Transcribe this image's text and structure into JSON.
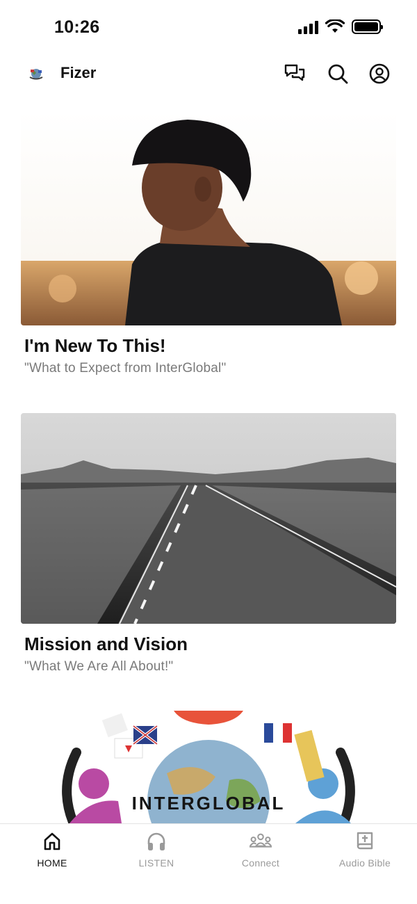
{
  "status_bar": {
    "time": "10:26"
  },
  "header": {
    "app_name": "Fizer"
  },
  "cards": [
    {
      "title": "I'm New To This!",
      "subtitle": "\"What to Expect from InterGlobal\""
    },
    {
      "title": "Mission and Vision",
      "subtitle": "\"What We Are All About!\""
    }
  ],
  "banner": {
    "logo_text": "INTERGLOBAL"
  },
  "nav": {
    "items": [
      {
        "label": "HOME",
        "icon": "home-icon",
        "active": true
      },
      {
        "label": "LISTEN",
        "icon": "headphones-icon",
        "active": false
      },
      {
        "label": "Connect",
        "icon": "people-icon",
        "active": false
      },
      {
        "label": "Audio Bible",
        "icon": "bible-icon",
        "active": false
      }
    ]
  },
  "colors": {
    "active": "#111111",
    "inactive": "#9a9a9a",
    "subtitle": "#7a7a7a"
  }
}
